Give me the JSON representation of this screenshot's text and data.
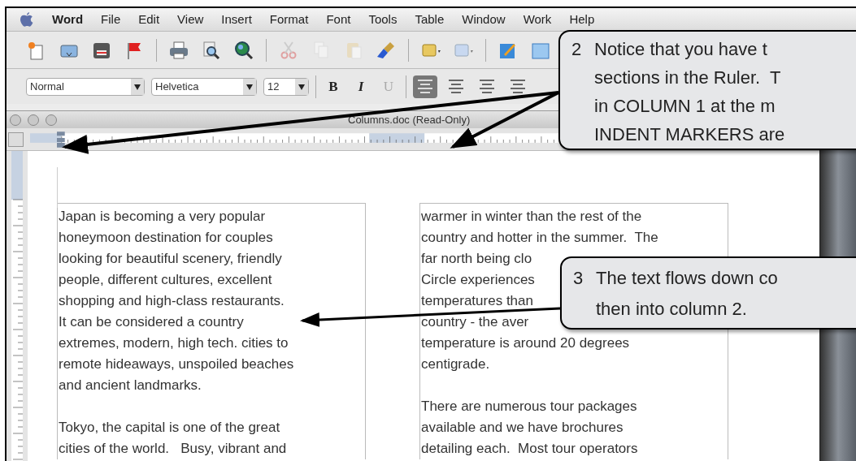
{
  "menu_bar": {
    "items": [
      {
        "label": "Word",
        "kind": "app"
      },
      {
        "label": "File",
        "kind": "menu"
      },
      {
        "label": "Edit",
        "kind": "menu"
      },
      {
        "label": "View",
        "kind": "menu"
      },
      {
        "label": "Insert",
        "kind": "menu"
      },
      {
        "label": "Format",
        "kind": "menu"
      },
      {
        "label": "Font",
        "kind": "menu"
      },
      {
        "label": "Tools",
        "kind": "menu"
      },
      {
        "label": "Table",
        "kind": "menu"
      },
      {
        "label": "Window",
        "kind": "menu"
      },
      {
        "label": "Work",
        "kind": "menu"
      },
      {
        "label": "Help",
        "kind": "menu"
      }
    ]
  },
  "format_bar": {
    "style": "Normal",
    "font": "Helvetica",
    "size": "12",
    "text_buttons": [
      {
        "label": "B",
        "kind": "bold"
      },
      {
        "label": "I",
        "kind": "italic"
      },
      {
        "label": "U",
        "kind": "underline"
      }
    ],
    "alignment": [
      {
        "selected": true
      },
      {
        "selected": false
      },
      {
        "selected": false
      },
      {
        "selected": false
      }
    ]
  },
  "window": {
    "title": "Columns.doc (Read-Only)"
  },
  "document": {
    "columns": [
      {
        "paragraphs": [
          [
            "Japan is becoming a very popular",
            "honeymoon destination for couples",
            "looking for beautiful scenery, friendly",
            "people, different cultures, excellent",
            "shopping and high-class restaurants.",
            "It can be considered a country",
            "extremes, modern, high tech. cities to",
            "remote hideaways, unspoiled beaches",
            "and ancient landmarks."
          ],
          [
            "Tokyo, the capital is one of the great",
            "cities of the world.   Busy, vibrant and"
          ]
        ]
      },
      {
        "paragraphs": [
          [
            "warmer in winter than the rest of the",
            "country and hotter in the summer.  The",
            "far north being clo",
            "Circle experiences",
            "temperatures than",
            "country - the aver",
            "temperature is around 20 degrees",
            "centigrade."
          ],
          [
            "There are numerous tour packages",
            "available and we have brochures",
            "detailing each.  Most tour operators"
          ]
        ]
      }
    ]
  },
  "callouts": [
    {
      "number": "2",
      "lines": [
        "Notice that you have t",
        "sections in the Ruler.  T",
        "in COLUMN 1 at the m",
        "INDENT MARKERS are"
      ]
    },
    {
      "number": "3",
      "lines": [
        "The text flows down co",
        "then into column 2."
      ]
    }
  ]
}
